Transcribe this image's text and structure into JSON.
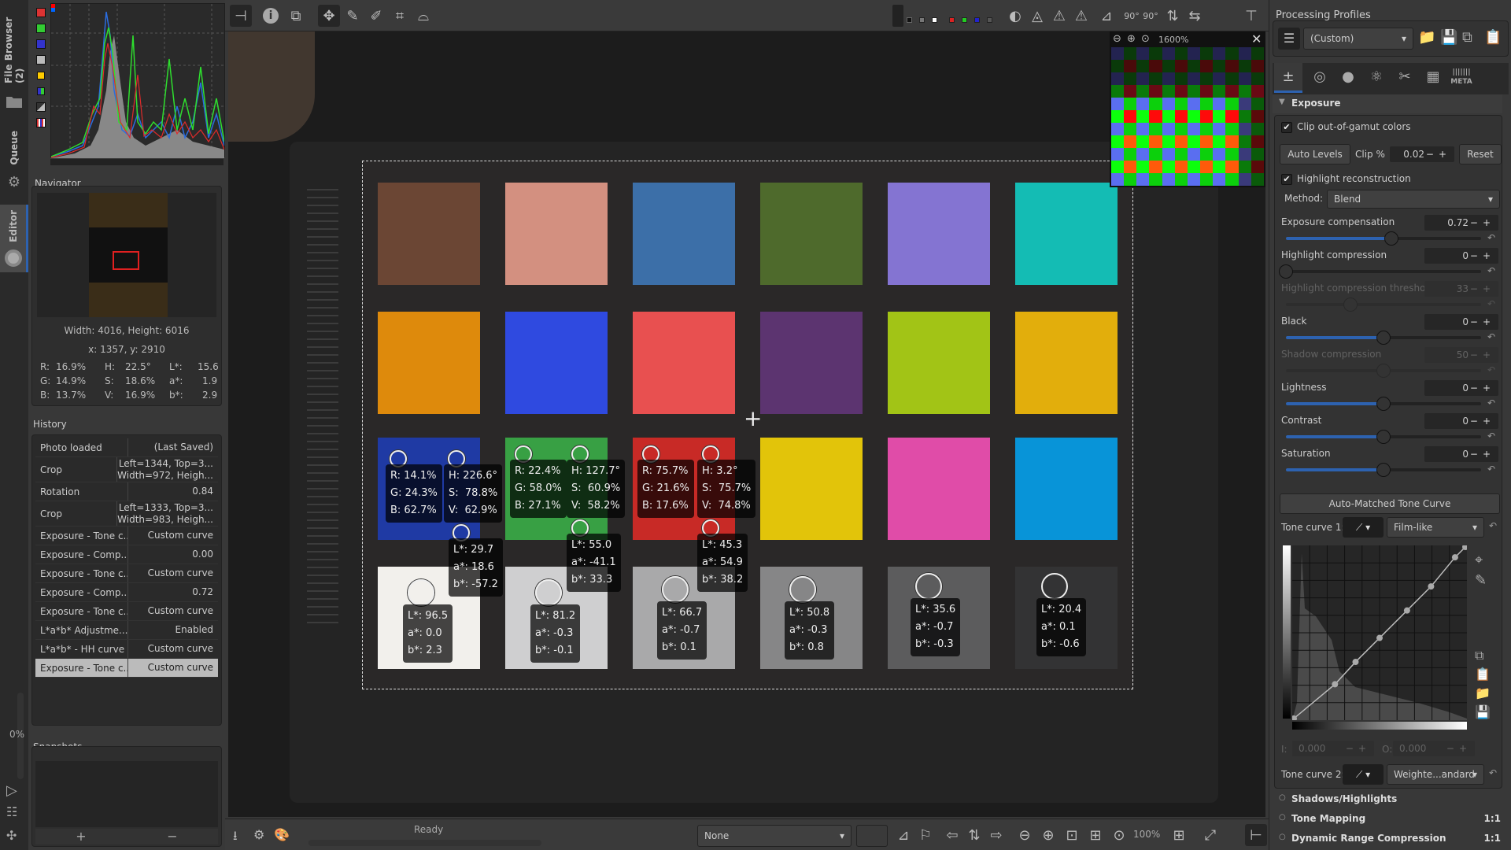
{
  "vertical_tabs": [
    {
      "label": "File Browser (2)",
      "icon": "folder-icon"
    },
    {
      "label": "Queue",
      "icon": "gears-icon"
    },
    {
      "label": "Editor",
      "icon": "aperture-icon",
      "active": true
    }
  ],
  "queue_progress": "0%",
  "histogram": {
    "buttons": [
      "red-channel",
      "green-channel",
      "blue-channel",
      "luminance",
      "chroma",
      "raw",
      "bar-display",
      "histogram-type"
    ]
  },
  "navigator": {
    "title": "Navigator",
    "dimensions": "Width: 4016, Height: 6016",
    "coords": "x: 1357, y: 2910",
    "values": {
      "r_label": "R:",
      "r": "16.9%",
      "g_label": "G:",
      "g": "14.9%",
      "b_label": "B:",
      "b": "13.7%",
      "h_label": "H:",
      "h": "22.5°",
      "s_label": "S:",
      "s": "18.6%",
      "v_label": "V:",
      "v": "16.9%",
      "l_label": "L*:",
      "l": "15.6",
      "a_label": "a*:",
      "a": "1.9",
      "bb_label": "b*:",
      "bb": "2.9"
    }
  },
  "history": {
    "title": "History",
    "items": [
      {
        "action": "Photo loaded",
        "value": "(Last Saved)"
      },
      {
        "action": "Crop",
        "value": "Left=1344, Top=3...\nWidth=972, Heigh..."
      },
      {
        "action": "Rotation",
        "value": "0.84"
      },
      {
        "action": "Crop",
        "value": "Left=1333, Top=3...\nWidth=983, Heigh..."
      },
      {
        "action": "Exposure - Tone c...",
        "value": "Custom curve"
      },
      {
        "action": "Exposure - Comp...",
        "value": "0.00"
      },
      {
        "action": "Exposure - Tone c...",
        "value": "Custom curve"
      },
      {
        "action": "Exposure - Comp...",
        "value": "0.72"
      },
      {
        "action": "Exposure - Tone c...",
        "value": "Custom curve"
      },
      {
        "action": "L*a*b* Adjustme...",
        "value": "Enabled"
      },
      {
        "action": "L*a*b* - HH curve",
        "value": "Custom curve"
      },
      {
        "action": "Exposure - Tone c...",
        "value": "Custom curve",
        "selected": true
      }
    ]
  },
  "snapshots": {
    "title": "Snapshots",
    "add": "+",
    "remove": "−"
  },
  "toolbar": {
    "left": [
      "hide-left-panel",
      "info",
      "before-after",
      "hand-tool",
      "white-balance-picker",
      "color-picker",
      "crop",
      "straighten"
    ],
    "right": [
      "preview-rgb",
      "preview-r",
      "preview-g",
      "preview-b",
      "focus-mask",
      "shadow-clipping",
      "highlight-clipping",
      "gamut-warning",
      "soft-proof",
      "rotate-left",
      "rotate-right",
      "flip-horizontal",
      "flip-vertical",
      "hide-right-panel"
    ],
    "rotate_label": "90°"
  },
  "detail_window": {
    "zoom": "1600%"
  },
  "color_checker": {
    "rows": [
      [
        "#6b4634",
        "#d39080",
        "#3c6fa8",
        "#4e6a2c",
        "#8474d2",
        "#14bcb4"
      ],
      [
        "#de8a0c",
        "#2f4ae0",
        "#e85050",
        "#5c3470",
        "#a2c416",
        "#e2ae0c"
      ],
      [
        "#1f3aa4",
        "#38a044",
        "#c82a26",
        "#e2c40a",
        "#e04ca8",
        "#0894d8"
      ],
      [
        "#f2f0ec",
        "#cfcfd0",
        "#a9a9aa",
        "#868687",
        "#5c5c5d",
        "#333334"
      ]
    ]
  },
  "readouts": {
    "blue_rgb": "R: 14.1%\nG: 24.3%\nB: 62.7%",
    "blue_hsv": "H: 226.6°\nS:  78.8%\nV:  62.9%",
    "blue_lab": "L*: 29.7\na*: 18.6\nb*: -57.2",
    "green_rgb": "R: 22.4%\nG: 58.0%\nB: 27.1%",
    "green_hsv": "H: 127.7°\nS:  60.9%\nV:  58.2%",
    "green_lab": "L*: 55.0\na*: -41.1\nb*: 33.3",
    "red_rgb": "R: 75.7%\nG: 21.6%\nB: 17.6%",
    "red_hsv": "H: 3.2°\nS:  75.7%\nV:  74.8%",
    "red_lab": "L*: 45.3\na*: 54.9\nb*: 38.2",
    "gray1": "L*: 96.5\na*: 0.0\nb*: 2.3",
    "gray2": "L*: 81.2\na*: -0.3\nb*: -0.1",
    "gray3": "L*: 66.7\na*: -0.7\nb*: 0.1",
    "gray4": "L*: 50.8\na*: -0.3\nb*: 0.8",
    "gray5": "L*: 35.6\na*: -0.7\nb*: -0.3",
    "gray6": "L*: 20.4\na*: 0.1\nb*: -0.6"
  },
  "bottombar": {
    "status": "Ready",
    "output_profile": "None",
    "zoom_level": "100%"
  },
  "right_panel": {
    "profiles_title": "Processing Profiles",
    "profile_value": "(Custom)",
    "tool_tabs": [
      "exposure",
      "details",
      "color",
      "advanced",
      "transform",
      "raw",
      "meta"
    ],
    "meta_label": "META",
    "exposure": {
      "title": "Exposure",
      "clip_gamut": "Clip out-of-gamut colors",
      "auto_levels": "Auto Levels",
      "clip_label": "Clip %",
      "clip_value": "0.02",
      "reset": "Reset",
      "highlight_recon": "Highlight reconstruction",
      "method_label": "Method:",
      "method_value": "Blend",
      "sliders": [
        {
          "label": "Exposure compensation",
          "value": "0.72",
          "pos": 0.54,
          "fill": true
        },
        {
          "label": "Highlight compression",
          "value": "0",
          "pos": 0.0,
          "fill": false
        },
        {
          "label": "Highlight compression threshold",
          "value": "33",
          "pos": 0.33,
          "fill": false,
          "disabled": true
        },
        {
          "label": "Black",
          "value": "0",
          "pos": 0.5,
          "fill": true
        },
        {
          "label": "Shadow compression",
          "value": "50",
          "pos": 0.5,
          "fill": false,
          "disabled": true
        },
        {
          "label": "Lightness",
          "value": "0",
          "pos": 0.5,
          "fill": true
        },
        {
          "label": "Contrast",
          "value": "0",
          "pos": 0.5,
          "fill": true
        },
        {
          "label": "Saturation",
          "value": "0",
          "pos": 0.5,
          "fill": true
        }
      ],
      "auto_matched": "Auto-Matched Tone Curve",
      "tone_curve1_label": "Tone curve 1:",
      "tone_curve1_mode": "Film-like",
      "tone_curve2_label": "Tone curve 2:",
      "tone_curve2_mode": "Weighte...andard",
      "i_label": "I:",
      "i_value": "0.000",
      "o_label": "O:",
      "o_value": "0.000"
    },
    "sections": [
      {
        "label": "Shadows/Highlights",
        "badge": ""
      },
      {
        "label": "Tone Mapping",
        "badge": "1:1"
      },
      {
        "label": "Dynamic Range Compression",
        "badge": "1:1"
      }
    ]
  }
}
